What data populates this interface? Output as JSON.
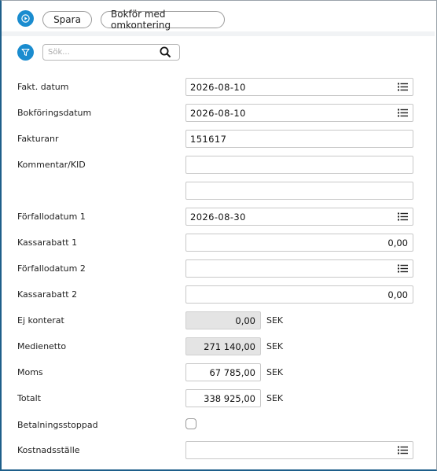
{
  "toolbar": {
    "play_icon": "play-icon",
    "save_label": "Spara",
    "book_label": "Bokför med omkontering"
  },
  "search": {
    "filter_icon": "filter-icon",
    "placeholder": "Sök...",
    "value": ""
  },
  "colors": {
    "accent": "#1a8ccf",
    "frame": "#1e5f8a",
    "readonly_bg": "#e4e4e4"
  },
  "form": {
    "invoice_date": {
      "label": "Fakt. datum",
      "value": "2026-08-10"
    },
    "booking_date": {
      "label": "Bokföringsdatum",
      "value": "2026-08-10"
    },
    "invoice_no": {
      "label": "Fakturanr",
      "value": "151617"
    },
    "comment": {
      "label": "Kommentar/KID",
      "value": "",
      "value2": ""
    },
    "due_date_1": {
      "label": "Förfallodatum 1",
      "value": "2026-08-30"
    },
    "cash_discount_1": {
      "label": "Kassarabatt 1",
      "value": "0,00"
    },
    "due_date_2": {
      "label": "Förfallodatum 2",
      "value": ""
    },
    "cash_discount_2": {
      "label": "Kassarabatt 2",
      "value": "0,00"
    },
    "not_posted": {
      "label": "Ej konterat",
      "value": "0,00",
      "unit": "SEK"
    },
    "medienetto": {
      "label": "Medienetto",
      "value": "271 140,00",
      "unit": "SEK"
    },
    "vat": {
      "label": "Moms",
      "value": "67 785,00",
      "unit": "SEK"
    },
    "total": {
      "label": "Totalt",
      "value": "338 925,00",
      "unit": "SEK"
    },
    "payment_stopped": {
      "label": "Betalningsstoppad",
      "checked": false
    },
    "cost_center": {
      "label": "Kostnadsställe",
      "value": ""
    }
  }
}
